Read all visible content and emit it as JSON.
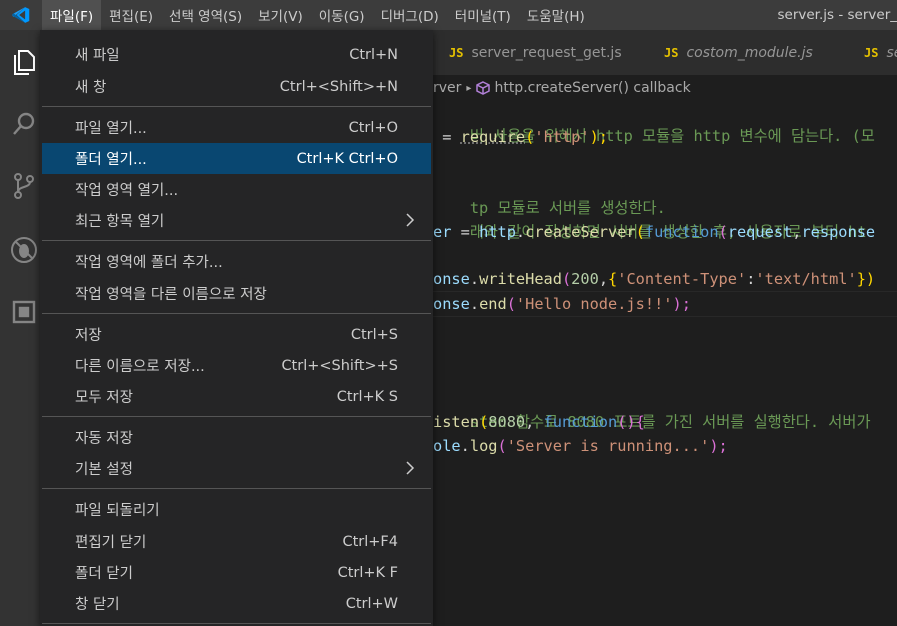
{
  "menubar": {
    "items": [
      {
        "label": "파일(F)"
      },
      {
        "label": "편집(E)"
      },
      {
        "label": "선택 영역(S)"
      },
      {
        "label": "보기(V)"
      },
      {
        "label": "이동(G)"
      },
      {
        "label": "디버그(D)"
      },
      {
        "label": "터미널(T)"
      },
      {
        "label": "도움말(H)"
      }
    ],
    "window_title": "server.js - server_"
  },
  "tabs": [
    {
      "label": "server_request_get.js",
      "icon_label": "JS"
    },
    {
      "label": "costom_module.js",
      "icon_label": "JS"
    },
    {
      "label": "se",
      "icon_label": "JS"
    }
  ],
  "breadcrumb": {
    "part1": "rver",
    "part2": "http.createServer() callback"
  },
  "code": {
    "l1_comment": "버 사용을 위해서 http 모듈을 http 변수에 담는다. (모",
    "l2_op": " = ",
    "l2_fn": "require",
    "l2_p1": "(",
    "l2_str": "'http'",
    "l2_p2": ");",
    "l4_comment": "tp 모듈로 서버를 생성한다.",
    "l5_comment": "래와 같이 작성하면 서버를 생성한 후, 사용자로 부터 ht",
    "l6_var": "er",
    "l6_eq": " = ",
    "l6_obj": "http",
    "l6_dot": ".",
    "l6_fn": "createServer",
    "l6_p1": "(",
    "l6_kw": "function",
    "l6_p2": "(",
    "l6_arg1": "request",
    "l6_comma": ",",
    "l6_arg2": "response",
    "l8_obj": "onse",
    "l8_dot": ".",
    "l8_fn": "writeHead",
    "l8_p1": "(",
    "l8_num": "200",
    "l8_c": ",",
    "l8_b1": "{",
    "l8_s1": "'Content-Type'",
    "l8_col": ":",
    "l8_s2": "'text/html'",
    "l8_b2": "})",
    "l9_obj": "onse",
    "l9_dot": ".",
    "l9_fn": "end",
    "l9_p1": "(",
    "l9_str": "'Hello node.js!!'",
    "l9_p2": ");",
    "l13_comment": "sten 함수로 8080 포트를 가진 서버를 실행한다. 서버가",
    "l14_fn": "isten",
    "l14_p1": "(",
    "l14_num": "8080",
    "l14_c": ", ",
    "l14_kw": "function",
    "l14_p2": "()",
    "l14_b": "{",
    "l15_obj": "ole",
    "l15_dot": ".",
    "l15_fn": "log",
    "l15_p1": "(",
    "l15_str": "'Server is running...'",
    "l15_p2": ");"
  },
  "file_menu": {
    "items": [
      {
        "label": "새 파일",
        "shortcut": "Ctrl+N"
      },
      {
        "label": "새 창",
        "shortcut": "Ctrl+<Shift>+N"
      },
      {
        "label": "파일 열기...",
        "shortcut": "Ctrl+O"
      },
      {
        "label": "폴더 열기...",
        "shortcut": "Ctrl+K Ctrl+O"
      },
      {
        "label": "작업 영역 열기...",
        "shortcut": ""
      },
      {
        "label": "최근 항목 열기",
        "shortcut": ""
      },
      {
        "label": "작업 영역에 폴더 추가...",
        "shortcut": ""
      },
      {
        "label": "작업 영역을 다른 이름으로 저장",
        "shortcut": ""
      },
      {
        "label": "저장",
        "shortcut": "Ctrl+S"
      },
      {
        "label": "다른 이름으로 저장...",
        "shortcut": "Ctrl+<Shift>+S"
      },
      {
        "label": "모두 저장",
        "shortcut": "Ctrl+K S"
      },
      {
        "label": "자동 저장",
        "shortcut": ""
      },
      {
        "label": "기본 설정",
        "shortcut": ""
      },
      {
        "label": "파일 되돌리기",
        "shortcut": ""
      },
      {
        "label": "편집기 닫기",
        "shortcut": "Ctrl+F4"
      },
      {
        "label": "폴더 닫기",
        "shortcut": "Ctrl+K F"
      },
      {
        "label": "창 닫기",
        "shortcut": "Ctrl+W"
      }
    ]
  },
  "colors": {
    "menu_bg": "#252526",
    "selected_bg": "#094771",
    "menubar_bg": "#3c3c3c",
    "activitybar_bg": "#333333",
    "editor_bg": "#1e1e1e",
    "js_icon": "#e5c100",
    "vscode_blue": "#0098ff"
  },
  "icons": [
    "vscode-logo-icon",
    "explorer-icon",
    "search-icon",
    "source-control-icon",
    "debug-icon",
    "extensions-icon",
    "chevron-right-icon",
    "method-icon"
  ]
}
